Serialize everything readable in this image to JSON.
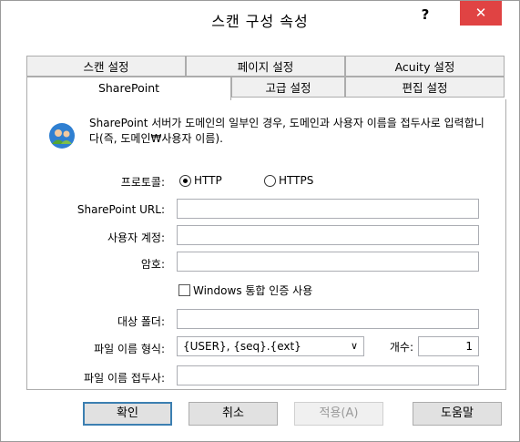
{
  "window": {
    "title": "스캔 구성 속성",
    "help_label": "?",
    "close_label": "✕"
  },
  "tabs_row1": [
    {
      "label": "스캔 설정"
    },
    {
      "label": "페이지 설정"
    },
    {
      "label": "Acuity 설정"
    }
  ],
  "tabs_row2": [
    {
      "label": "SharePoint",
      "active": true
    },
    {
      "label": "고급 설정"
    },
    {
      "label": "편집 설정"
    }
  ],
  "info": {
    "icon": "users-icon",
    "text": "SharePoint 서버가 도메인의 일부인 경우, 도메인과 사용자 이름을 접두사로 입력합니다(즉, 도메인₩사용자 이름)."
  },
  "protocol": {
    "label": "프로토콜:",
    "http": "HTTP",
    "https": "HTTPS",
    "selected": "HTTP"
  },
  "sharepoint_url": {
    "label": "SharePoint URL:",
    "value": ""
  },
  "user_account": {
    "label": "사용자 계정:",
    "value": ""
  },
  "password": {
    "label": "암호:",
    "value": ""
  },
  "windows_auth": {
    "label": "Windows 통합 인증 사용",
    "checked": false
  },
  "target_folder": {
    "label": "대상 폴더:",
    "value": ""
  },
  "file_name_format": {
    "label": "파일 이름 형식:",
    "value": "{USER}, {seq}.{ext}"
  },
  "count": {
    "label": "개수:",
    "value": "1"
  },
  "file_name_prefix": {
    "label": "파일 이름 접두사:",
    "value": ""
  },
  "buttons": {
    "ok": "확인",
    "cancel": "취소",
    "apply": "적용(A)",
    "help": "도움말"
  }
}
